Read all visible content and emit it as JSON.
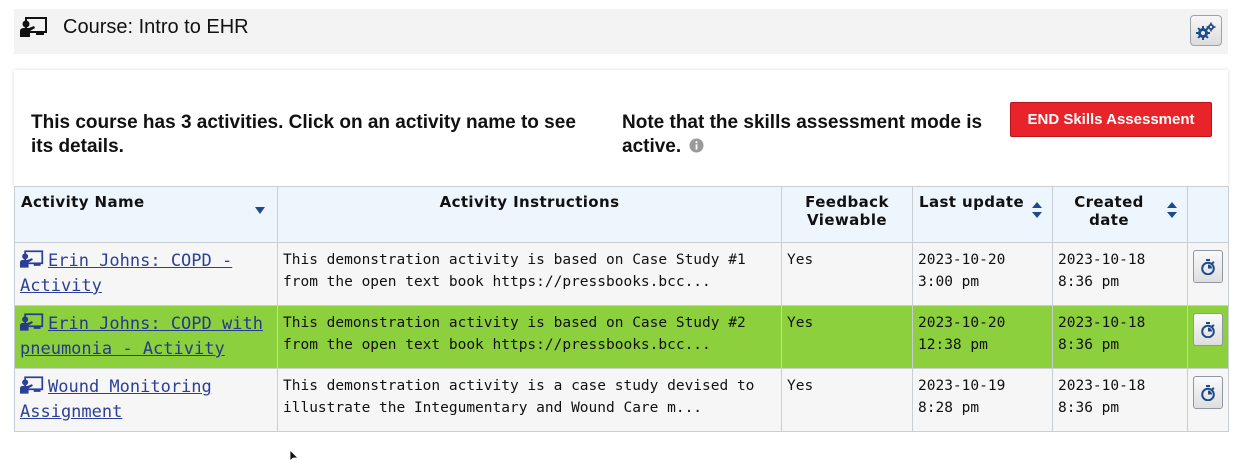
{
  "header": {
    "course_title": "Course: Intro to EHR",
    "course_icon": "teacher-board-icon",
    "settings_icon": "gears-icon"
  },
  "intro": {
    "text": "This course has 3 activities.  Click on an activity name to see its details.",
    "note": "Note that the skills assessment mode is active.",
    "info_icon": "info-circle-icon",
    "end_button_label": "END Skills Assessment",
    "end_button_color": "#e8232a"
  },
  "table": {
    "columns": {
      "name": "Activity Name",
      "instructions": "Activity Instructions",
      "feedback": "Feedback Viewable",
      "last_update": "Last update",
      "created": "Created date"
    },
    "rows": [
      {
        "name": "Erin Johns: COPD - Activity",
        "instructions": "This demonstration activity is based on Case Study #1 from the open text book https://pressbooks.bcc...",
        "feedback": "Yes",
        "last_update_date": "2023-10-20",
        "last_update_time": "3:00 pm",
        "created_date": "2023-10-18",
        "created_time": "8:36 pm",
        "selected": false
      },
      {
        "name": "Erin Johns: COPD with pneumonia - Activity",
        "instructions": "This demonstration activity is based on Case Study #2 from the open text book https://pressbooks.bcc...",
        "feedback": "Yes",
        "last_update_date": "2023-10-20",
        "last_update_time": "12:38 pm",
        "created_date": "2023-10-18",
        "created_time": "8:36 pm",
        "selected": true
      },
      {
        "name": "Wound Monitoring Assignment",
        "instructions": "This demonstration activity is a case study devised to illustrate the Integumentary and Wound Care m...",
        "feedback": "Yes",
        "last_update_date": "2023-10-19",
        "last_update_time": "8:28 pm",
        "created_date": "2023-10-18",
        "created_time": "8:36 pm",
        "selected": false
      }
    ],
    "row_icon": "teacher-board-icon",
    "action_icon": "stopwatch-icon",
    "selected_row_color": "#8dd03d",
    "link_color": "#2b3f99"
  }
}
